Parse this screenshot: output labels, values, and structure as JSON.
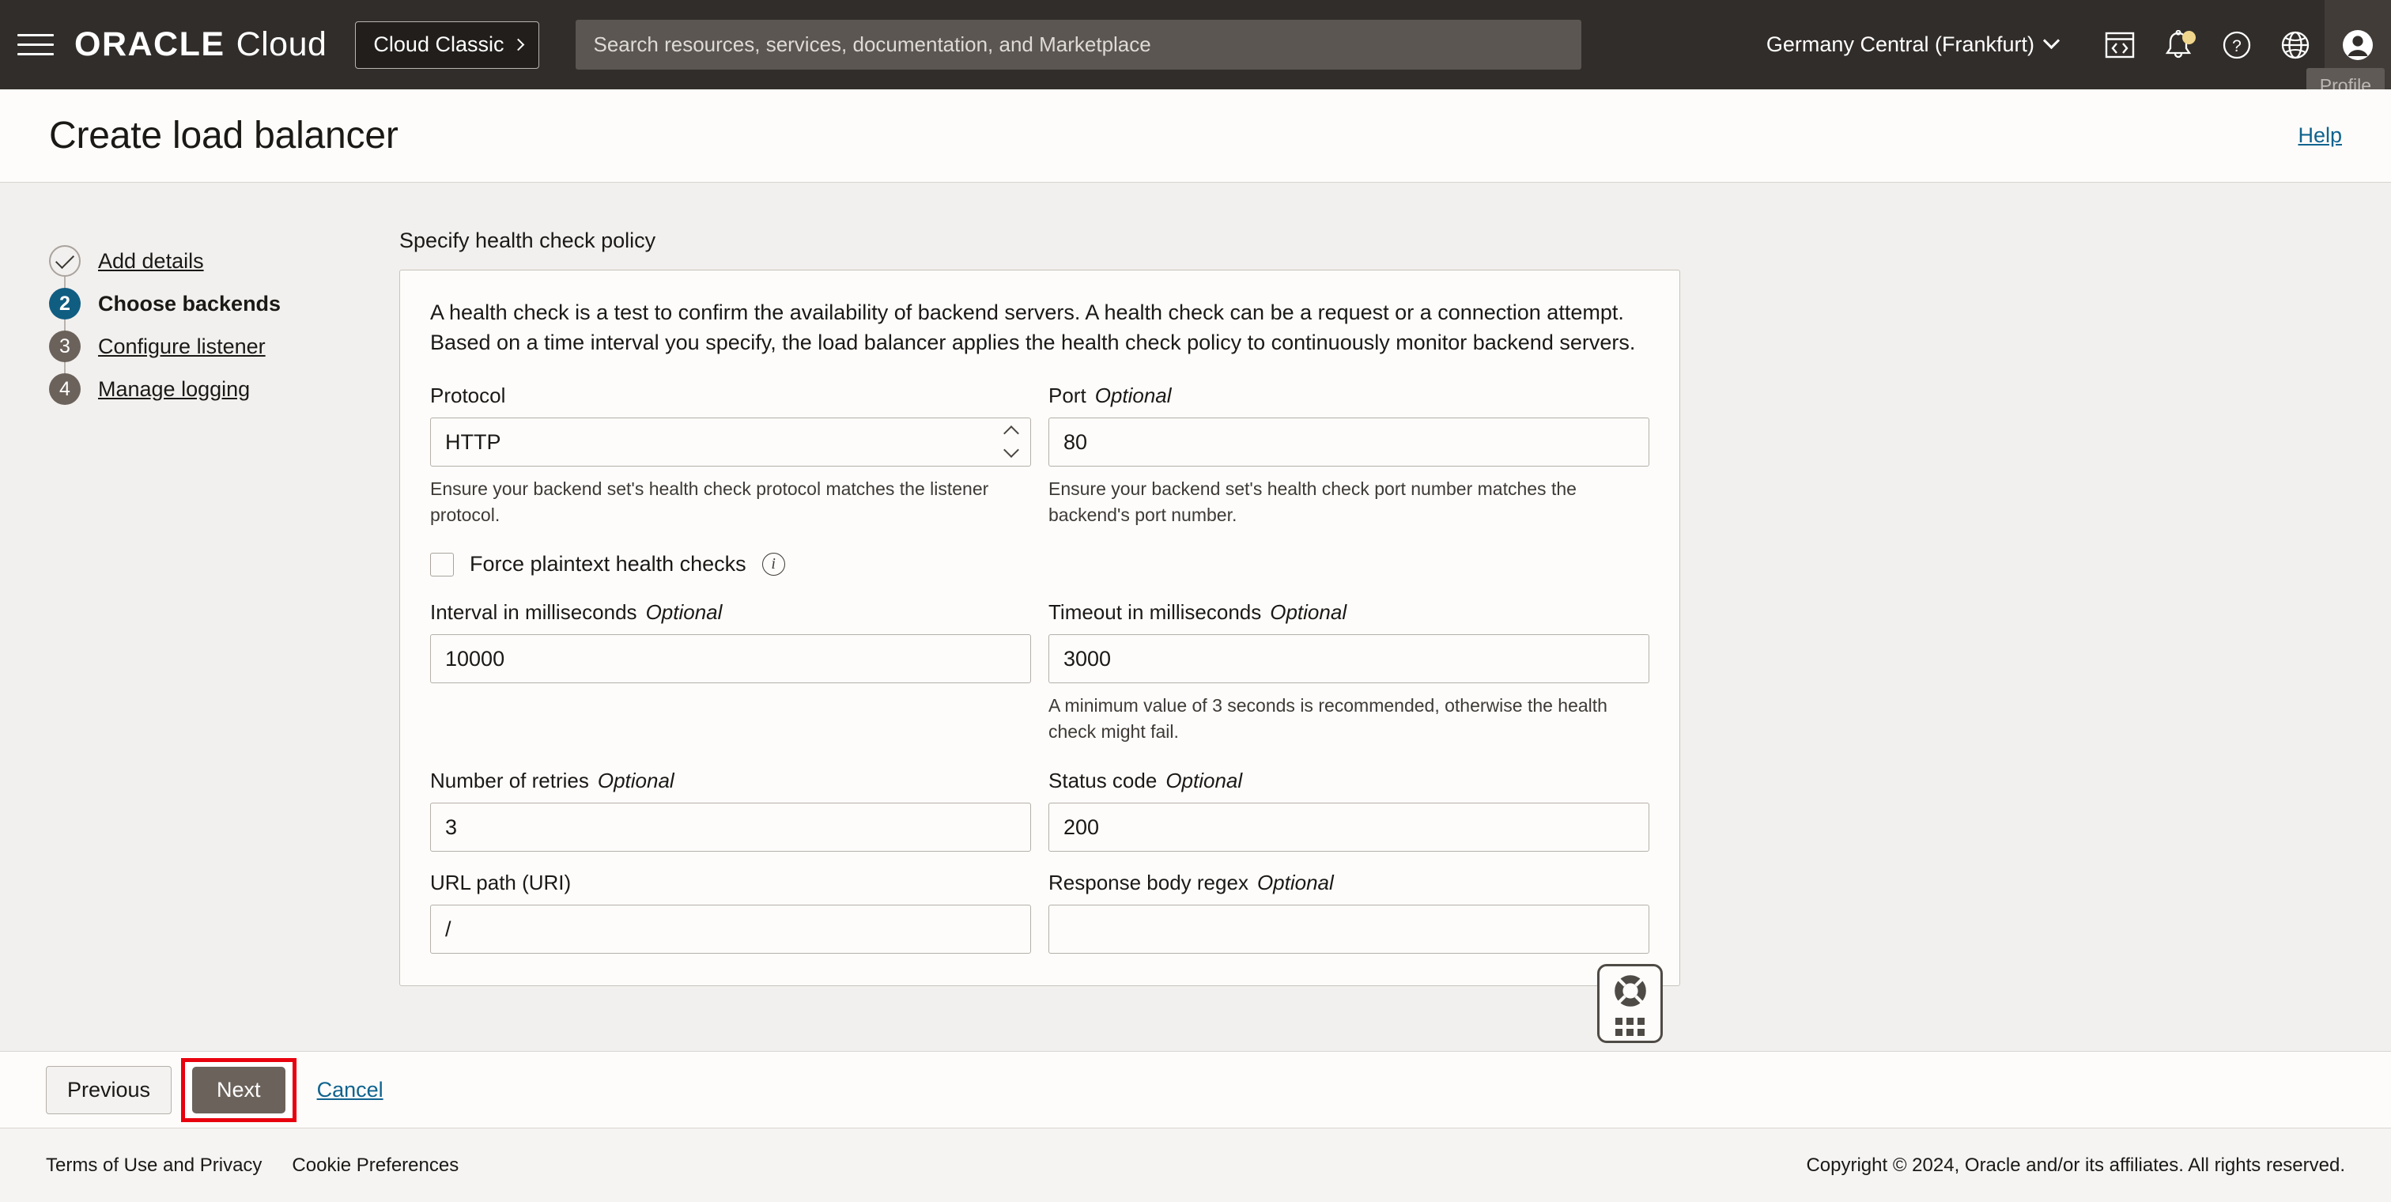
{
  "topnav": {
    "brand_oracle": "ORACLE",
    "brand_cloud": "Cloud",
    "cloud_classic_label": "Cloud Classic",
    "search_placeholder": "Search resources, services, documentation, and Marketplace",
    "search_value": "",
    "region": "Germany Central (Frankfurt)",
    "profile_tooltip": "Profile",
    "icons": [
      "cloud-shell-icon",
      "notifications-bell-icon",
      "help-question-icon",
      "language-globe-icon",
      "profile-avatar-icon"
    ]
  },
  "pageheader": {
    "title": "Create load balancer",
    "help_label": "Help"
  },
  "steps": [
    {
      "marker": "✓",
      "label": "Add details",
      "state": "done"
    },
    {
      "marker": "2",
      "label": "Choose backends",
      "state": "active"
    },
    {
      "marker": "3",
      "label": "Configure listener",
      "state": "todo"
    },
    {
      "marker": "4",
      "label": "Manage logging",
      "state": "todo"
    }
  ],
  "panel": {
    "heading": "Specify health check policy",
    "intro": "A health check is a test to confirm the availability of backend servers. A health check can be a request or a connection attempt. Based on a time interval you specify, the load balancer applies the health check policy to continuously monitor backend servers."
  },
  "fields": {
    "protocol": {
      "label": "Protocol",
      "value": "HTTP",
      "helper": "Ensure your backend set's health check protocol matches the listener protocol."
    },
    "port": {
      "label": "Port",
      "optional": "Optional",
      "value": "80",
      "helper": "Ensure your backend set's health check port number matches the backend's port number."
    },
    "force_plaintext": {
      "label": "Force plaintext health checks",
      "checked": false
    },
    "interval": {
      "label": "Interval in milliseconds",
      "optional": "Optional",
      "value": "10000"
    },
    "timeout": {
      "label": "Timeout in milliseconds",
      "optional": "Optional",
      "value": "3000",
      "helper": "A minimum value of 3 seconds is recommended, otherwise the health check might fail."
    },
    "retries": {
      "label": "Number of retries",
      "optional": "Optional",
      "value": "3"
    },
    "status_code": {
      "label": "Status code",
      "optional": "Optional",
      "value": "200"
    },
    "url_path": {
      "label": "URL path (URI)",
      "value": "/"
    },
    "response_regex": {
      "label": "Response body regex",
      "optional": "Optional",
      "value": ""
    }
  },
  "actions": {
    "previous": "Previous",
    "next": "Next",
    "cancel": "Cancel"
  },
  "footer": {
    "terms": "Terms of Use and Privacy",
    "cookies": "Cookie Preferences",
    "copyright": "Copyright © 2024, Oracle and/or its affiliates. All rights reserved."
  },
  "colors": {
    "nav_bg": "#312d2a",
    "accent_link": "#10638f",
    "step_active": "#105d82",
    "highlight_box": "#e8000d",
    "next_btn": "#6b625b"
  }
}
